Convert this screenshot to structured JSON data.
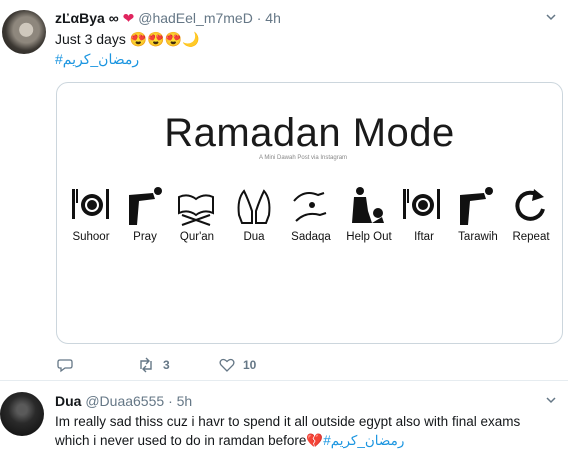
{
  "tweet1": {
    "name": "zĽαBya ∞",
    "handle": "@hadEel_m7meD",
    "time": "· 4h",
    "text": "Just 3 days 😍😍😍🌙",
    "hashtag": "#رمضان_كريم",
    "card": {
      "title": "Ramadan Mode",
      "subtitle": "A Mini Dawah Post via Instagram",
      "items": [
        {
          "label": "Suhoor",
          "icon": "plate-cutlery-icon"
        },
        {
          "label": "Pray",
          "icon": "pray-bowing-icon"
        },
        {
          "label": "Qur'an",
          "icon": "quran-book-icon"
        },
        {
          "label": "Dua",
          "icon": "dua-hands-icon"
        },
        {
          "label": "Sadaqa",
          "icon": "charity-hands-icon"
        },
        {
          "label": "Help Out",
          "icon": "help-person-icon"
        },
        {
          "label": "Iftar",
          "icon": "plate-cutlery-icon"
        },
        {
          "label": "Tarawih",
          "icon": "pray-bowing-icon"
        },
        {
          "label": "Repeat",
          "icon": "repeat-arrow-icon"
        }
      ]
    },
    "retweets": "3",
    "likes": "10"
  },
  "tweet2": {
    "name": "Dua",
    "handle": "@Duaa6555",
    "time": "· 5h",
    "line1": "Im really sad thiss cuz i havr to spend it all outside egypt also with final exams",
    "line2": "which i never used to do in ramdan before💔",
    "hashtag": "#رمضان_كريم"
  },
  "colors": {
    "link": "#1b95e0",
    "muted": "#657786",
    "heart": "#e0245e"
  }
}
